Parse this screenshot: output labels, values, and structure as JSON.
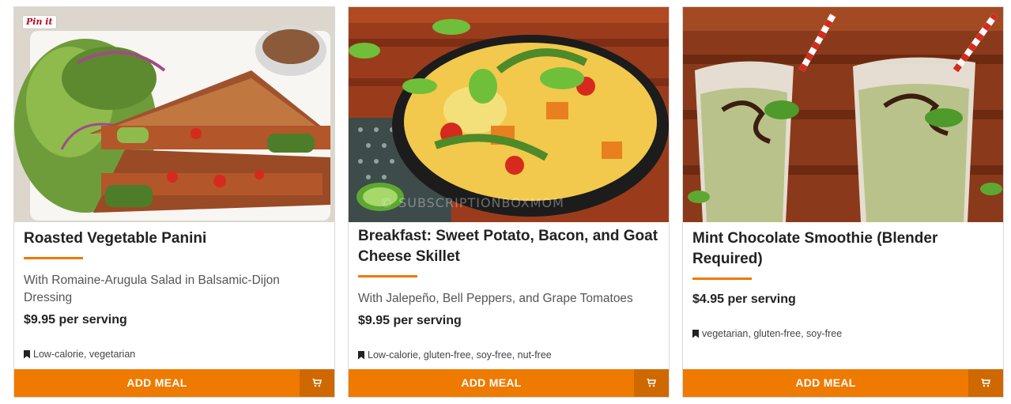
{
  "cards": [
    {
      "title": "Roasted Vegetable Panini",
      "description": "With Romaine-Arugula Salad in Balsamic-Dijon Dressing",
      "price": "$9.95 per serving",
      "tags": "Low-calorie, vegetarian",
      "add_label": "ADD MEAL",
      "image_desc_icon": "panini-photo",
      "pin_label": "Pin it"
    },
    {
      "title": "Breakfast: Sweet Potato, Bacon, and Goat Cheese Skillet",
      "description": "With Jalepeño, Bell Peppers, and Grape Tomatoes",
      "price": "$9.95 per serving",
      "tags": "Low-calorie, gluten-free, soy-free, nut-free",
      "add_label": "ADD MEAL",
      "image_desc_icon": "skillet-photo",
      "watermark": "© SUBSCRIPTIONBOXMOM"
    },
    {
      "title": "Mint Chocolate Smoothie (Blender Required)",
      "price": "$4.95 per serving",
      "tags": "vegetarian, gluten-free, soy-free",
      "add_label": "ADD MEAL",
      "image_desc_icon": "smoothie-photo"
    }
  ],
  "colors": {
    "accent": "#ee7a00",
    "accent_dark": "#d06800",
    "title_text": "#222222"
  },
  "icons": {
    "tag": "bookmark-icon",
    "cart": "cart-icon"
  }
}
